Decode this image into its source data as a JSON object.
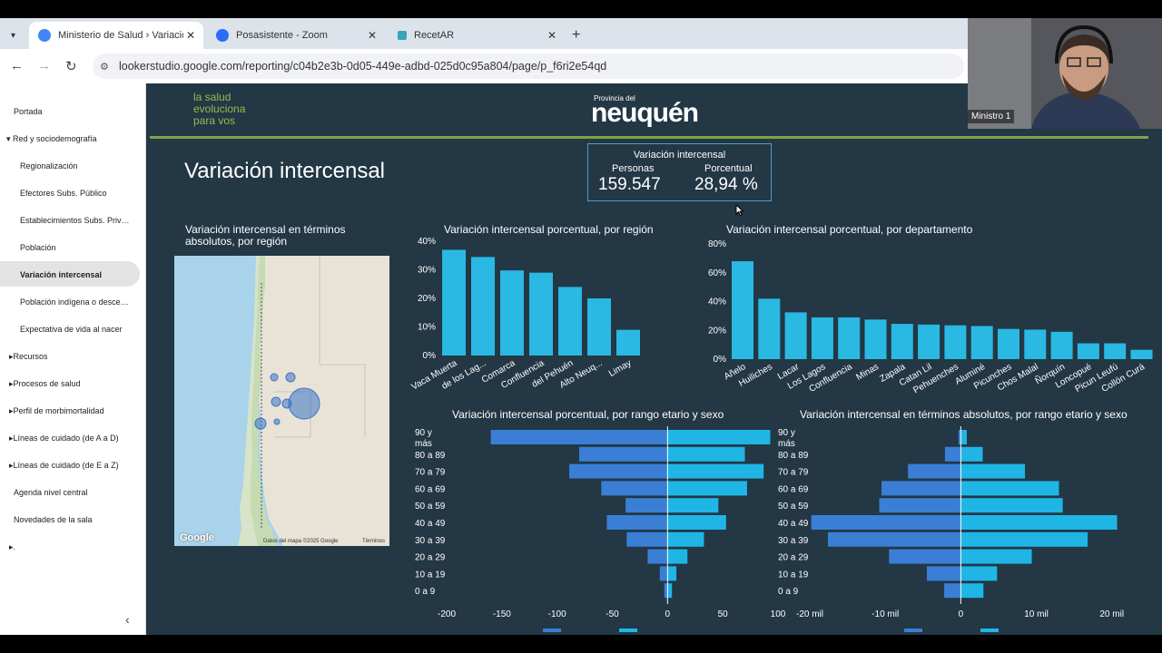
{
  "browser": {
    "tabs": [
      {
        "title": "Ministerio de Salud › Variación intercensal",
        "icon": "looker-studio-icon"
      },
      {
        "title": "Posasistente - Zoom",
        "icon": "zoom-icon"
      },
      {
        "title": "RecetAR",
        "icon": "recetar-icon"
      }
    ],
    "url": "lookerstudio.google.com/reporting/c04b2e3b-0d05-449e-adbd-025d0c95a804/page/p_f6ri2e54qd"
  },
  "sidebar": {
    "items": [
      {
        "label": "Portada"
      },
      {
        "label": "Red y sociodemografía",
        "expanded": true
      },
      {
        "label": "Regionalización"
      },
      {
        "label": "Efectores Subs. Público"
      },
      {
        "label": "Establecimientos Subs. Privados"
      },
      {
        "label": "Población"
      },
      {
        "label": "Variación intercensal",
        "active": true
      },
      {
        "label": "Población indígena o descendiente"
      },
      {
        "label": "Expectativa de vida al nacer"
      },
      {
        "label": "Recursos"
      },
      {
        "label": "Procesos de salud"
      },
      {
        "label": "Perfil de morbimortalidad"
      },
      {
        "label": "Líneas de cuidado (de A a D)"
      },
      {
        "label": "Líneas de cuidado (de E a Z)"
      },
      {
        "label": "Agenda nivel central"
      },
      {
        "label": "Novedades de la sala"
      },
      {
        "label": "."
      }
    ]
  },
  "header": {
    "tagline": [
      "la salud",
      "evoluciona",
      "para vos"
    ],
    "logo_small": "Provincia del",
    "logo_big": "neuquén"
  },
  "page_title": "Variación intercensal",
  "kpi": {
    "title": "Variación intercensal",
    "label_personas": "Personas",
    "value_personas": "159.547",
    "label_porcentual": "Porcentual",
    "value_porcentual": "28,94 %"
  },
  "map": {
    "title_line1": "Variación intercensal en términos",
    "title_line2": "absolutos, por región",
    "google": "Google",
    "attribution": "Datos del mapa ©2025 Google",
    "terms": "Términos"
  },
  "webcam": {
    "name": "Ministro 1"
  },
  "colors": {
    "dashboard_bg": "#233745",
    "bar": "#29b9e3",
    "male": "#3a7fd5",
    "female": "#1fb6e6",
    "accent_green": "#7ea34a"
  },
  "chart_data": [
    {
      "type": "bar",
      "title": "Variación intercensal porcentual, por región",
      "categories": [
        "Vaca Muerta",
        "de los Lag...",
        "Comarca",
        "Confluencia",
        "del Pehuén",
        "Alto Neuq...",
        "Limay"
      ],
      "values": [
        37,
        34.5,
        29.8,
        29,
        24,
        20,
        9
      ],
      "ylim": [
        0,
        40
      ],
      "yticks": [
        "0%",
        "10%",
        "20%",
        "30%",
        "40%"
      ]
    },
    {
      "type": "bar",
      "title": "Variación intercensal porcentual, por departamento",
      "categories": [
        "Añelo",
        "Huiliches",
        "Lacar",
        "Los Lagos",
        "Confluencia",
        "Minas",
        "Zapala",
        "Catan Lil",
        "Pehuenches",
        "Aluminé",
        "Picunches",
        "Chos Malal",
        "Ñorquín",
        "Loncopué",
        "Picun Leufú",
        "Collón Curá"
      ],
      "values": [
        68,
        42,
        32.5,
        29,
        29,
        27.5,
        24.5,
        24,
        23.5,
        23,
        21,
        20.5,
        19,
        11,
        11,
        6.5
      ],
      "ylim": [
        0,
        80
      ],
      "yticks": [
        "0%",
        "20%",
        "40%",
        "60%",
        "80%"
      ]
    },
    {
      "type": "bar",
      "title": "Variación intercensal porcentual, por rango etario y sexo",
      "categories": [
        "90 y más",
        "80 a 89",
        "70 a 79",
        "60 a 69",
        "50 a 59",
        "40 a 49",
        "30 a 39",
        "20 a 29",
        "10 a 19",
        "0 a 9"
      ],
      "series": [
        {
          "values": [
            -160,
            -80,
            -89,
            -60,
            -38,
            -55,
            -37,
            -18,
            -7,
            -3
          ]
        },
        {
          "values": [
            93,
            70,
            87,
            72,
            46,
            53,
            33,
            18,
            8,
            4
          ]
        }
      ],
      "xlim": [
        -200,
        100
      ],
      "xticks": [
        "-200",
        "-150",
        "-100",
        "-50",
        "0",
        "50",
        "100"
      ]
    },
    {
      "type": "bar",
      "title": "Variación intercensal en términos absolutos, por rango etario y sexo",
      "categories": [
        "90 y más",
        "80 a 89",
        "70 a 79",
        "60 a 69",
        "50 a 59",
        "40 a 49",
        "30 a 39",
        "20 a 29",
        "10 a 19",
        "0 a 9"
      ],
      "series": [
        {
          "values": [
            -300,
            -2100,
            -7000,
            -10500,
            -10800,
            -19800,
            -17600,
            -9500,
            -4500,
            -2200
          ]
        },
        {
          "values": [
            800,
            2900,
            8500,
            13000,
            13500,
            20700,
            16800,
            9400,
            4800,
            3000
          ]
        }
      ],
      "xlim": [
        -20000,
        24000
      ],
      "xticks": [
        "-20 mil",
        "-10 mil",
        "0",
        "10 mil",
        "20 mil"
      ]
    }
  ]
}
